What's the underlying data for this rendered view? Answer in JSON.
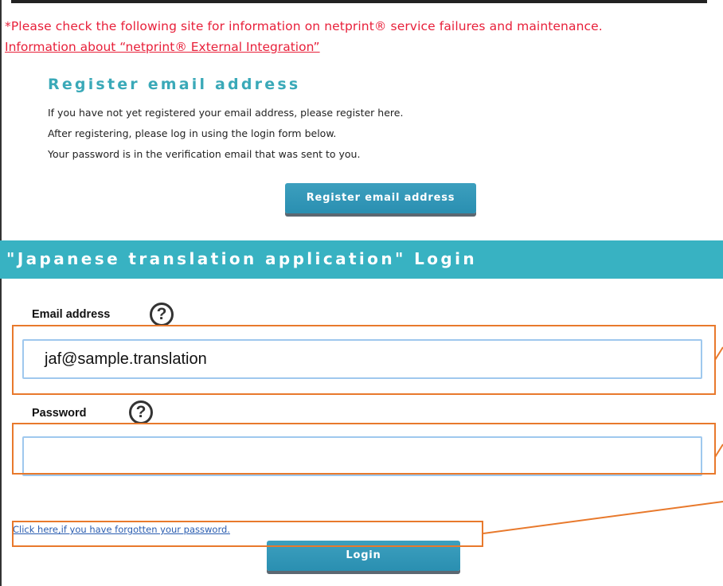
{
  "notice": {
    "text": "*Please check the following site for information on netprint® service failures and maintenance.",
    "link": "Information about “netprint® External Integration”"
  },
  "register": {
    "title": "Register email address",
    "lines": [
      "If you have not yet registered your email address, please register here.",
      "After registering, please log in using the login form below.",
      "Your password is in the verification email that was sent to you."
    ],
    "button": "Register email address"
  },
  "login": {
    "title": "\"Japanese translation application\" Login",
    "email_label": "Email address",
    "email_value": "jaf@sample.translation",
    "password_label": "Password",
    "password_value": "",
    "help_glyph": "?",
    "forgot_link": "Click here,if you have forgotten your password.",
    "button": "Login"
  },
  "colors": {
    "notice_red": "#e8203a",
    "teal": "#38b2c2",
    "button_blue": "#2a8fb1",
    "highlight_orange": "#e8792c",
    "link_blue": "#2a5db0"
  },
  "icons": [
    "help-icon"
  ]
}
